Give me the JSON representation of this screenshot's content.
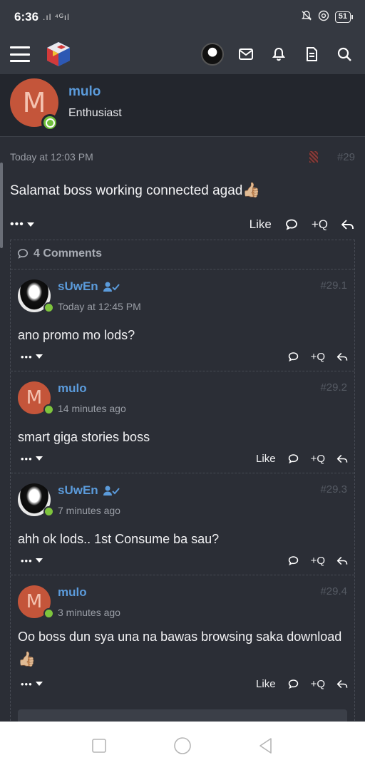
{
  "status_bar": {
    "time": "6:36",
    "signal": ".ıl ⁴ᴳıl",
    "battery": "51"
  },
  "nav": {
    "icons": [
      "menu-icon",
      "site-logo",
      "user-avatar",
      "envelope-icon",
      "bell-icon",
      "document-icon",
      "search-icon"
    ]
  },
  "author": {
    "initial": "M",
    "name": "mulo",
    "title": "Enthusiast"
  },
  "post": {
    "date": "Today at 12:03 PM",
    "number": "#29",
    "body": "Salamat boss working connected agad",
    "emoji": "👍🏼",
    "more": "•••",
    "like": "Like",
    "quote": "+Q"
  },
  "comments": {
    "header": "4 Comments",
    "items": [
      {
        "name": "sUwEn",
        "time": "Today at 12:45 PM",
        "number": "#29.1",
        "body": "ano promo mo lods?",
        "more": "•••",
        "quote": "+Q"
      },
      {
        "initial": "M",
        "name": "mulo",
        "time": "14 minutes ago",
        "number": "#29.2",
        "body": "smart giga stories boss",
        "more": "•••",
        "like": "Like",
        "quote": "+Q"
      },
      {
        "name": "sUwEn",
        "time": "7 minutes ago",
        "number": "#29.3",
        "body": "ahh ok lods.. 1st Consume ba sau?",
        "more": "•••",
        "quote": "+Q"
      },
      {
        "initial": "M",
        "name": "mulo",
        "time": "3 minutes ago",
        "number": "#29.4",
        "body": "Oo boss dun sya una na bawas browsing saka download",
        "emoji": "👍🏼",
        "more": "•••",
        "like": "Like",
        "quote": "+Q"
      }
    ]
  },
  "colors": {
    "accent": "#5b9bdb",
    "online": "#7ec43d",
    "avatar_bg": "#c4553a",
    "background": "#2b2e36"
  }
}
